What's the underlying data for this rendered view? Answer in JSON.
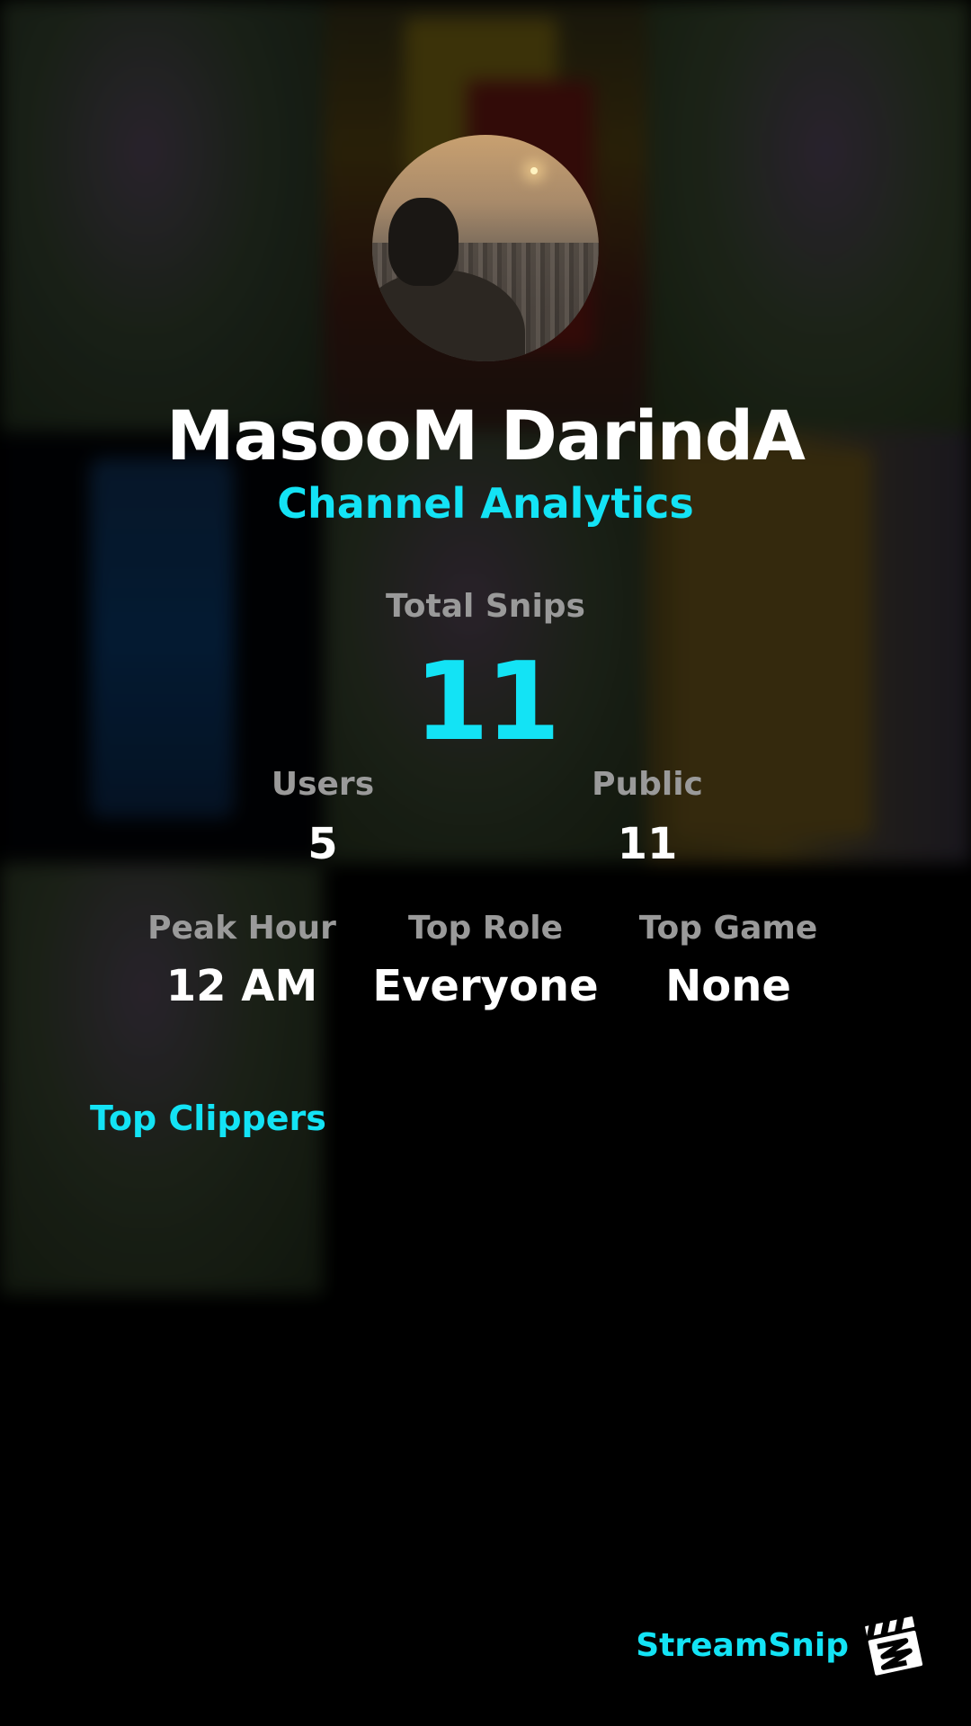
{
  "header": {
    "channel_name": "MasooM DarindA",
    "subtitle": "Channel Analytics"
  },
  "total": {
    "label": "Total Snips",
    "value": "11"
  },
  "stats_row1": [
    {
      "label": "Users",
      "value": "5"
    },
    {
      "label": "Public",
      "value": "11"
    }
  ],
  "stats_row2": [
    {
      "label": "Peak Hour",
      "value": "12 AM"
    },
    {
      "label": "Top Role",
      "value": "Everyone"
    },
    {
      "label": "Top Game",
      "value": "None"
    }
  ],
  "sections": {
    "top_clippers": "Top Clippers"
  },
  "brand": {
    "name": "StreamSnip",
    "logo_icon": "clapperboard-icon"
  },
  "colors": {
    "accent": "#13e3f5",
    "label": "#9a9a9a",
    "text": "#ffffff",
    "background": "#000000"
  }
}
